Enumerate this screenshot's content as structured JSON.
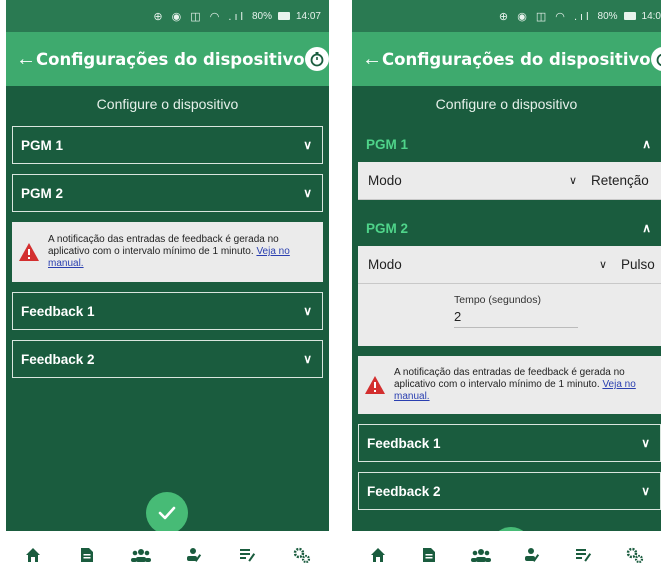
{
  "left": {
    "status": {
      "icons": "⊕ ◉ ◫ ◠ .ıl",
      "battery": "80%",
      "time": "14:07"
    },
    "appbar": {
      "title": "Configurações do dispositivo"
    },
    "heading": "Configure o dispositivo",
    "sections_top": [
      {
        "label": "PGM 1"
      },
      {
        "label": "PGM 2"
      }
    ],
    "notice": {
      "text": "A notificação das entradas de feedback é gerada no aplicativo com o intervalo mínimo de 1 minuto. ",
      "link": "Veja no manual."
    },
    "sections_bottom": [
      {
        "label": "Feedback 1"
      },
      {
        "label": "Feedback 2"
      }
    ]
  },
  "right": {
    "status": {
      "icons": "⊕ ◉ ◫ ◠ .ıl",
      "battery": "80%",
      "time": "14:0"
    },
    "appbar": {
      "title": "Configurações do dispositivo"
    },
    "heading": "Configure o dispositivo",
    "pgm1": {
      "label": "PGM 1",
      "mode_label": "Modo",
      "mode_value": "Retenção"
    },
    "pgm2": {
      "label": "PGM 2",
      "mode_label": "Modo",
      "mode_value": "Pulso",
      "time_label": "Tempo (segundos)",
      "time_value": "2"
    },
    "notice": {
      "text": "A notificação das entradas de feedback é gerada no aplicativo com o intervalo mínimo de 1 minuto. ",
      "link": "Veja no manual."
    },
    "sections_bottom": [
      {
        "label": "Feedback 1"
      },
      {
        "label": "Feedback 2"
      }
    ]
  },
  "nav_icons": [
    "home-icon",
    "document-icon",
    "group-icon",
    "user-edit-icon",
    "list-edit-icon",
    "settings-icon"
  ],
  "colors": {
    "primary": "#3eaa6e",
    "dark_bg": "#1a5c3e",
    "accent_green": "#4fd48a",
    "warning": "#d32f2f",
    "link": "#2a3fb0"
  }
}
